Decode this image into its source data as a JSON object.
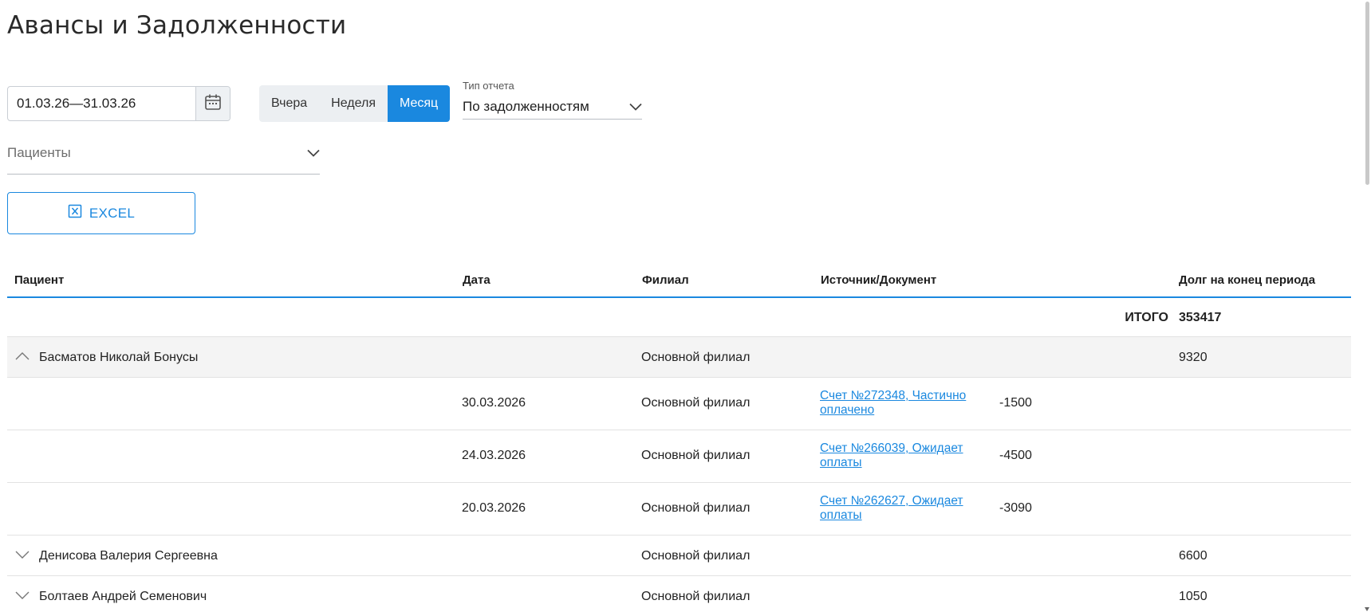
{
  "page": {
    "title": "Авансы и Задолженности"
  },
  "filters": {
    "date_range": "01.03.26—31.03.26",
    "period_buttons": [
      {
        "label": "Вчера",
        "active": false
      },
      {
        "label": "Неделя",
        "active": false
      },
      {
        "label": "Месяц",
        "active": true
      }
    ],
    "report_type": {
      "label": "Тип отчета",
      "value": "По задолженностям"
    },
    "patients_placeholder": "Пациенты"
  },
  "excel_button": {
    "label": "EXCEL"
  },
  "table": {
    "columns": {
      "patient": "Пациент",
      "date": "Дата",
      "branch": "Филиал",
      "source": "Источник/Документ",
      "debt": "Долг на конец периода"
    },
    "total": {
      "label": "ИТОГО",
      "value": "353417"
    },
    "groups": [
      {
        "patient": "Басматов Николай Бонусы",
        "branch": "Основной филиал",
        "debt": "9320",
        "expanded": true,
        "items": [
          {
            "date": "30.03.2026",
            "branch": "Основной филиал",
            "doc": "Счет №272348, Частично оплачено",
            "amount": "-1500"
          },
          {
            "date": "24.03.2026",
            "branch": "Основной филиал",
            "doc": "Счет №266039, Ожидает оплаты",
            "amount": "-4500"
          },
          {
            "date": "20.03.2026",
            "branch": "Основной филиал",
            "doc": "Счет №262627, Ожидает оплаты",
            "amount": "-3090"
          }
        ]
      },
      {
        "patient": "Денисова Валерия Сергеевна",
        "branch": "Основной филиал",
        "debt": "6600",
        "expanded": false
      },
      {
        "patient": "Болтаев Андрей Семенович",
        "branch": "Основной филиал",
        "debt": "1050",
        "expanded": false
      }
    ]
  },
  "colors": {
    "accent": "#1a88df",
    "expanded_row_bg": "#f4f4f4"
  }
}
